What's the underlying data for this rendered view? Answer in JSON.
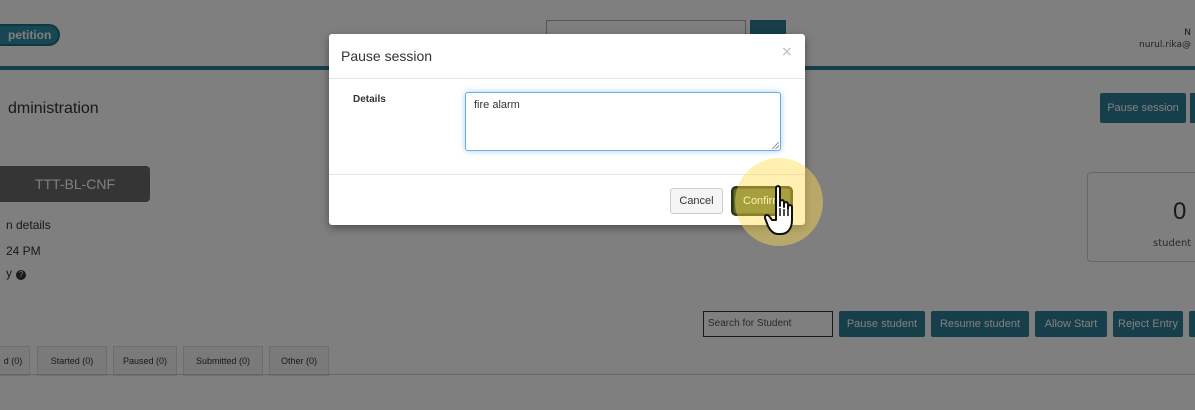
{
  "header": {
    "logo_text": "petition",
    "user_name": "N",
    "user_email": "nurul.rika@"
  },
  "page": {
    "title": "dministration",
    "pause_session_button": "Pause session"
  },
  "session": {
    "code": "TTT-BL-CNF",
    "details_link": "n details",
    "time": "24 PM",
    "help_prefix": "y"
  },
  "stats": {
    "value": "0",
    "label": "student"
  },
  "student_actions": {
    "search_placeholder": "Search for Student",
    "pause_student": "Pause student",
    "resume_student": "Resume student",
    "allow_start": "Allow Start",
    "reject_entry": "Reject Entry"
  },
  "tabs": [
    {
      "label": "d (0)"
    },
    {
      "label": "Started (0)"
    },
    {
      "label": "Paused (0)"
    },
    {
      "label": "Submitted (0)"
    },
    {
      "label": "Other (0)"
    }
  ],
  "modal": {
    "title": "Pause session",
    "close_glyph": "×",
    "details_label": "Details",
    "details_value": "fire alarm",
    "cancel_label": "Cancel",
    "confirm_label": "Confirm"
  },
  "colors": {
    "primary": "#2f7f96",
    "confirm": "#5c6e2e",
    "highlight": "#ffdc50"
  }
}
